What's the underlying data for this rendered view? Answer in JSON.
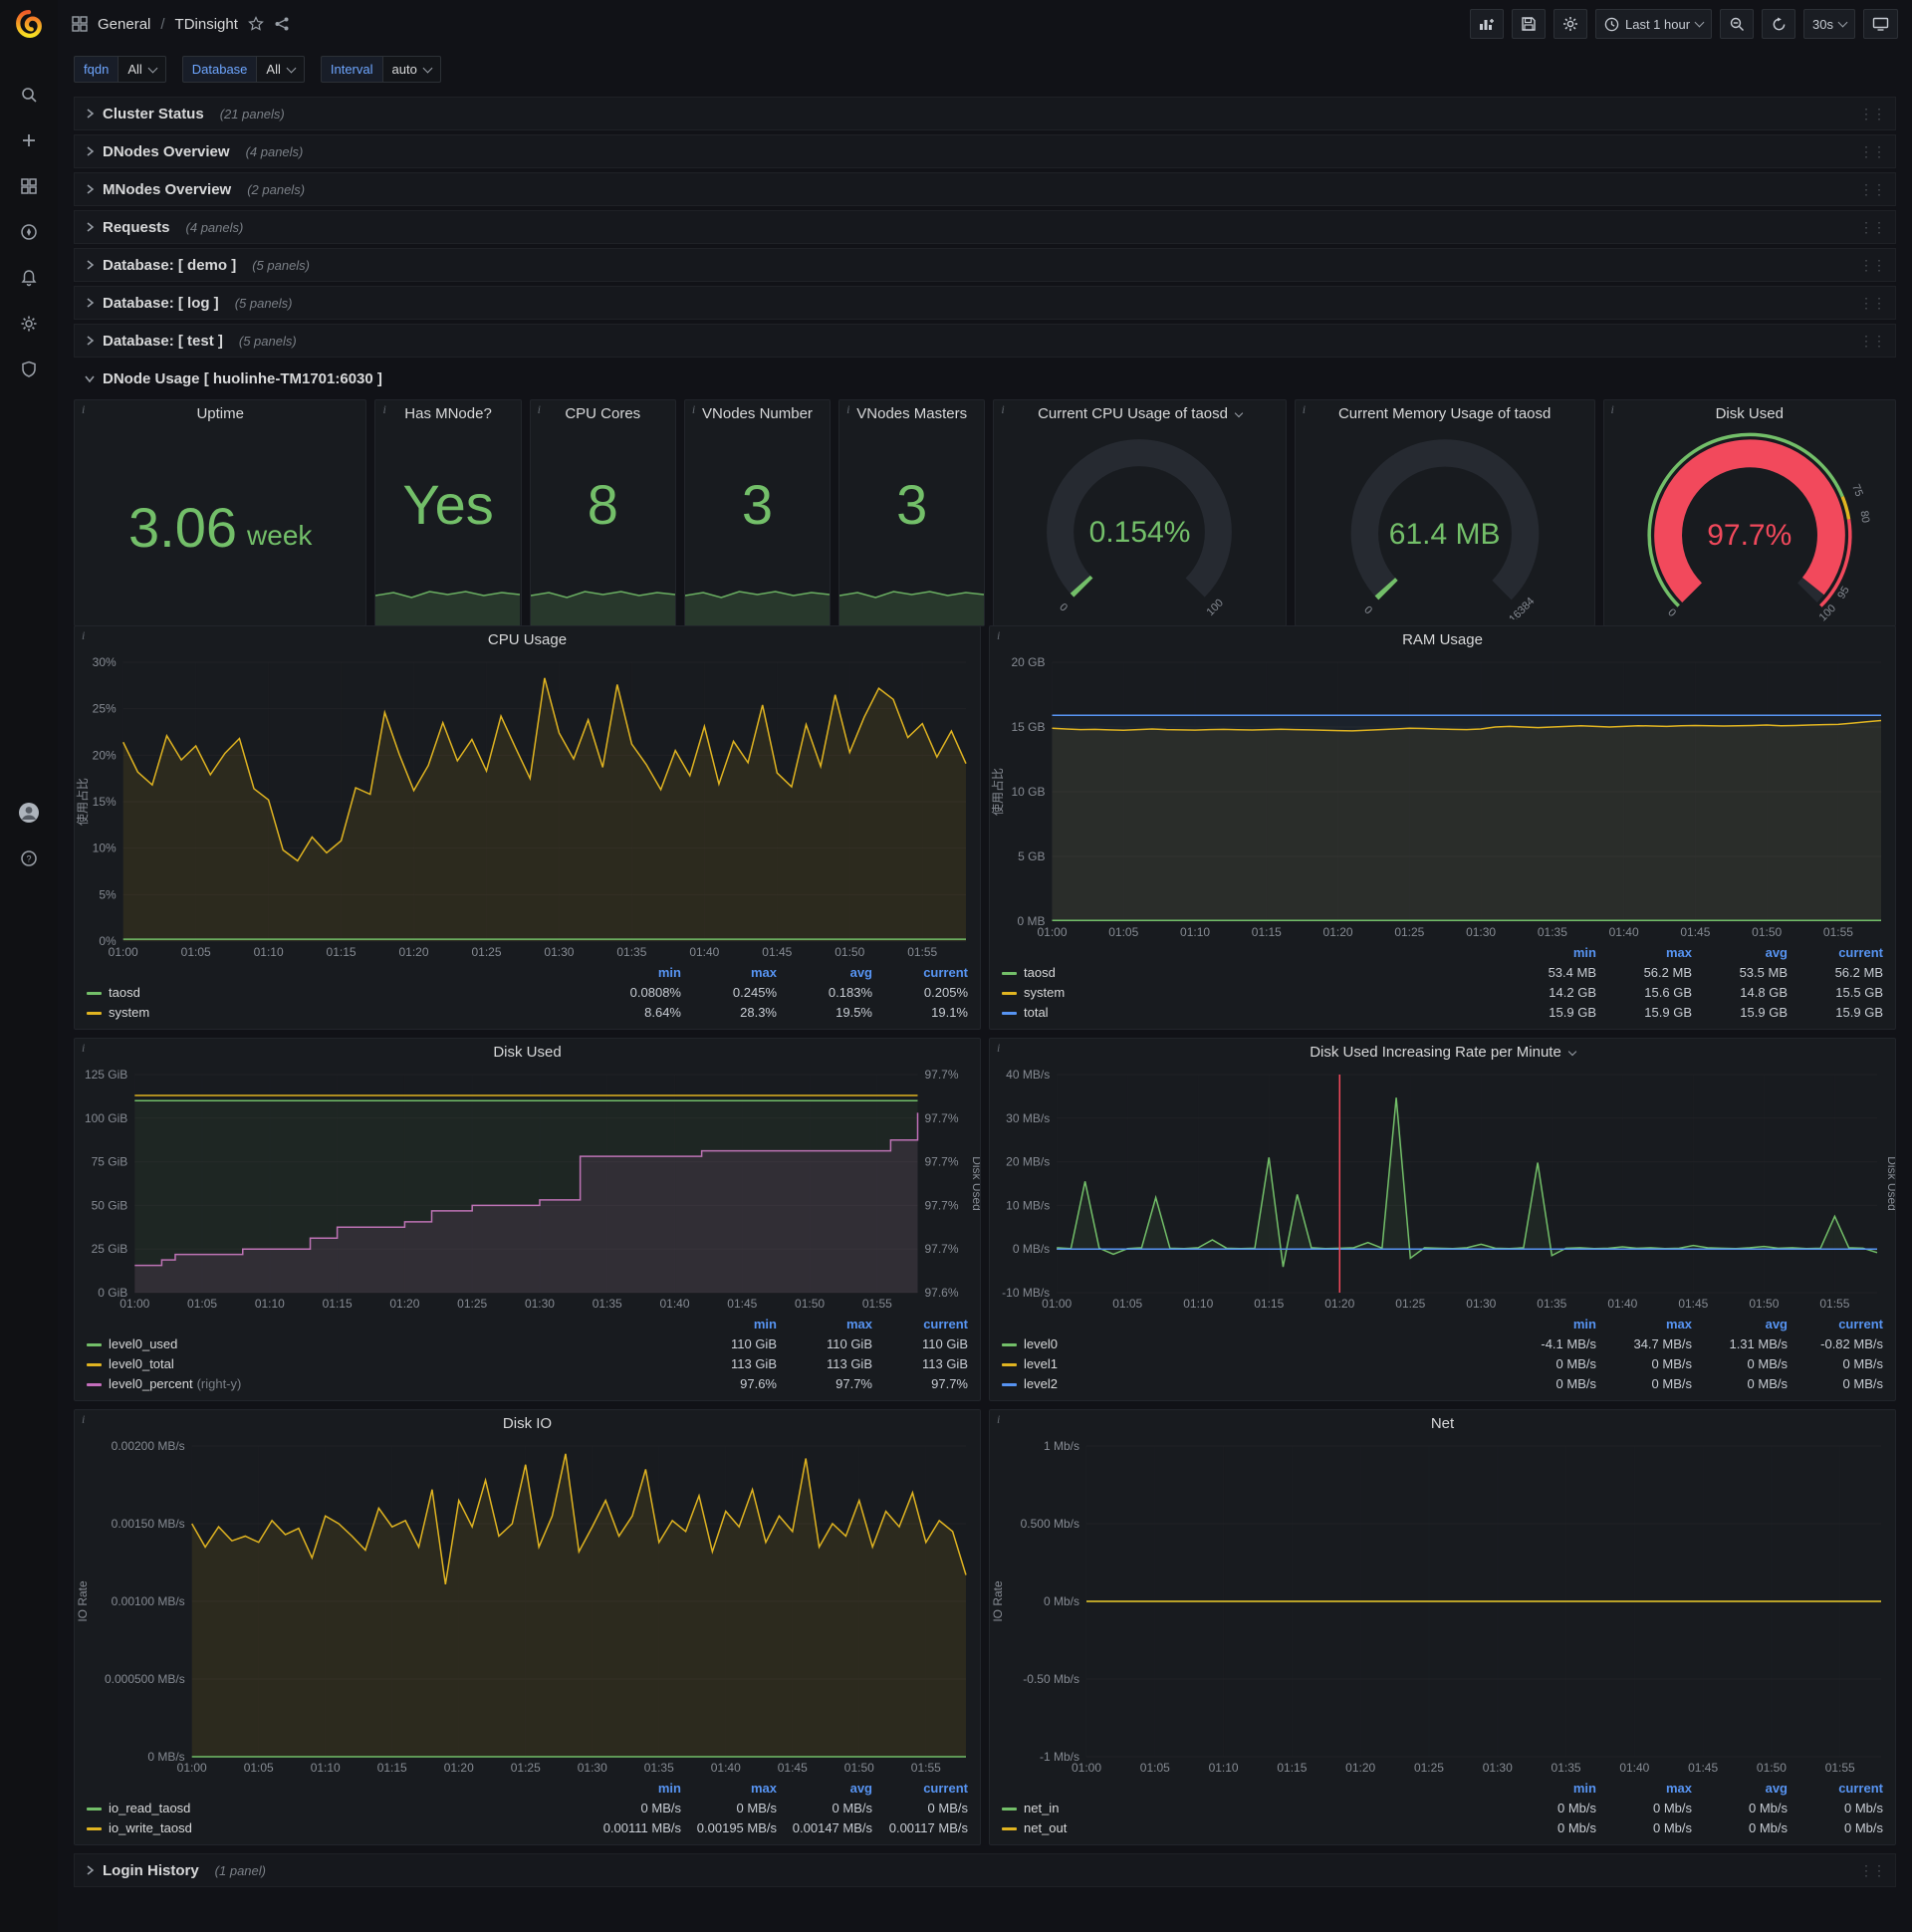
{
  "colors": {
    "green": "#73bf69",
    "yellow": "#e0b421",
    "blue": "#5794f2",
    "purple": "#c46ebc",
    "red": "#f2495c"
  },
  "topbar": {
    "section": "General",
    "title": "TDinsight",
    "time_range": "Last 1 hour",
    "refresh": "30s"
  },
  "variables": [
    {
      "label": "fqdn",
      "value": "All"
    },
    {
      "label": "Database",
      "value": "All"
    },
    {
      "label": "Interval",
      "value": "auto"
    }
  ],
  "rows_top": [
    {
      "title": "Cluster Status",
      "count": "(21 panels)"
    },
    {
      "title": "DNodes Overview",
      "count": "(4 panels)"
    },
    {
      "title": "MNodes Overview",
      "count": "(2 panels)"
    },
    {
      "title": "Requests",
      "count": "(4 panels)"
    },
    {
      "title": "Database: [ demo ]",
      "count": "(5 panels)"
    },
    {
      "title": "Database: [ log ]",
      "count": "(5 panels)"
    },
    {
      "title": "Database: [ test ]",
      "count": "(5 panels)"
    }
  ],
  "dnode_row_title": "DNode Usage [ huolinhe-TM1701:6030 ]",
  "rows_bottom": [
    {
      "title": "Login History",
      "count": "(1 panel)"
    }
  ],
  "stats": [
    {
      "title": "Uptime",
      "value": "3.06",
      "unit": "week",
      "spark": false
    },
    {
      "title": "Has MNode?",
      "value": "Yes",
      "spark": true
    },
    {
      "title": "CPU Cores",
      "value": "8",
      "spark": true
    },
    {
      "title": "VNodes Number",
      "value": "3",
      "spark": true
    },
    {
      "title": "VNodes Masters",
      "value": "3",
      "spark": true
    }
  ],
  "gauges": [
    {
      "title": "Current CPU Usage of taosd",
      "value": "0.154%",
      "percent": 0.154,
      "color": "#73bf69",
      "labels": [
        {
          "pct": 0,
          "text": "0"
        },
        {
          "pct": 100,
          "text": "100"
        }
      ]
    },
    {
      "title": "Current Memory Usage of taosd",
      "value": "61.4 MB",
      "percent": 0.375,
      "color": "#73bf69",
      "labels": [
        {
          "pct": 0,
          "text": "0"
        },
        {
          "pct": 100,
          "text": "16384"
        }
      ]
    },
    {
      "title": "Disk Used",
      "value": "97.7%",
      "percent": 97.7,
      "color": "#f2495c",
      "band": [
        {
          "from": 0,
          "to": 75,
          "color": "#73bf69"
        },
        {
          "from": 75,
          "to": 80,
          "color": "#e0b421"
        },
        {
          "from": 80,
          "to": 100,
          "color": "#f2495c"
        }
      ],
      "labels": [
        {
          "pct": 0,
          "text": "0"
        },
        {
          "pct": 75,
          "text": "75"
        },
        {
          "pct": 80,
          "text": "80"
        },
        {
          "pct": 95,
          "text": "95"
        },
        {
          "pct": 100,
          "text": "100"
        }
      ]
    }
  ],
  "chart_data": {
    "cpu": {
      "type": "line",
      "title": "CPU Usage",
      "ylabel": "使用占比",
      "ylim": [
        0,
        30
      ],
      "x_max": 58,
      "y_ticks": [
        {
          "v": 0,
          "label": "0%"
        },
        {
          "v": 5,
          "label": "5%"
        },
        {
          "v": 10,
          "label": "10%"
        },
        {
          "v": 15,
          "label": "15%"
        },
        {
          "v": 20,
          "label": "20%"
        },
        {
          "v": 25,
          "label": "25%"
        },
        {
          "v": 30,
          "label": "30%"
        }
      ],
      "x_ticks": [
        "01:00",
        "01:05",
        "01:10",
        "01:15",
        "01:20",
        "01:25",
        "01:30",
        "01:35",
        "01:40",
        "01:45",
        "01:50",
        "01:55"
      ],
      "series": [
        {
          "name": "system",
          "color": "yellow",
          "fill": 0.1,
          "values": [
            21.4,
            18.2,
            16.8,
            22.1,
            19.5,
            21.0,
            17.9,
            20.2,
            21.8,
            16.4,
            15.2,
            9.8,
            8.64,
            11.2,
            9.5,
            10.8,
            16.5,
            15.8,
            24.6,
            20.1,
            16.2,
            18.9,
            23.5,
            19.4,
            21.7,
            18.3,
            24.2,
            20.8,
            17.5,
            28.3,
            22.4,
            19.6,
            23.8,
            18.7,
            27.6,
            21.2,
            19.0,
            16.3,
            20.5,
            17.8,
            23.1,
            16.9,
            21.5,
            19.2,
            25.4,
            18.1,
            16.6,
            23.3,
            18.8,
            26.5,
            20.3,
            24.1,
            27.2,
            26.0,
            21.9,
            23.4,
            19.8,
            22.6,
            19.1
          ]
        },
        {
          "name": "taosd",
          "color": "green",
          "const": 0.2
        }
      ],
      "legend": {
        "headers": [
          "min",
          "max",
          "avg",
          "current"
        ],
        "rows": [
          {
            "name": "taosd",
            "color": "green",
            "values": [
              "0.0808%",
              "0.245%",
              "0.183%",
              "0.205%"
            ]
          },
          {
            "name": "system",
            "color": "yellow",
            "values": [
              "8.64%",
              "28.3%",
              "19.5%",
              "19.1%"
            ]
          }
        ]
      }
    },
    "ram": {
      "type": "line",
      "title": "RAM Usage",
      "ylabel": "使用占比",
      "ylim": [
        0,
        20
      ],
      "x_max": 58,
      "y_ticks": [
        {
          "v": 0,
          "label": "0 MB"
        },
        {
          "v": 5,
          "label": "5 GB"
        },
        {
          "v": 10,
          "label": "10 GB"
        },
        {
          "v": 15,
          "label": "15 GB"
        },
        {
          "v": 20,
          "label": "20 GB"
        }
      ],
      "x_ticks": [
        "01:00",
        "01:05",
        "01:10",
        "01:15",
        "01:20",
        "01:25",
        "01:30",
        "01:35",
        "01:40",
        "01:45",
        "01:50",
        "01:55"
      ],
      "series": [
        {
          "name": "total",
          "color": "blue",
          "const": 15.9,
          "fill": 0.06
        },
        {
          "name": "system",
          "color": "yellow",
          "fill": 0.08,
          "values": [
            14.9,
            14.85,
            14.8,
            14.82,
            14.78,
            14.75,
            14.8,
            14.85,
            14.8,
            14.78,
            14.76,
            14.8,
            14.82,
            14.79,
            14.77,
            14.8,
            14.83,
            14.8,
            14.78,
            14.75,
            14.72,
            14.7,
            14.75,
            14.8,
            14.85,
            14.9,
            14.88,
            14.85,
            14.82,
            14.8,
            14.85,
            15.0,
            15.05,
            15.0,
            14.95,
            15.0,
            15.05,
            15.1,
            15.05,
            15.0,
            15.05,
            15.1,
            15.08,
            15.05,
            15.1,
            15.12,
            15.1,
            15.08,
            15.1,
            15.12,
            15.15,
            15.1,
            15.12,
            15.15,
            15.18,
            15.2,
            15.3,
            15.4,
            15.5
          ]
        },
        {
          "name": "taosd",
          "color": "green",
          "const": 0.053
        }
      ],
      "legend": {
        "headers": [
          "min",
          "max",
          "avg",
          "current"
        ],
        "rows": [
          {
            "name": "taosd",
            "color": "green",
            "values": [
              "53.4 MB",
              "56.2 MB",
              "53.5 MB",
              "56.2 MB"
            ]
          },
          {
            "name": "system",
            "color": "yellow",
            "values": [
              "14.2 GB",
              "15.6 GB",
              "14.8 GB",
              "15.5 GB"
            ]
          },
          {
            "name": "total",
            "color": "blue",
            "values": [
              "15.9 GB",
              "15.9 GB",
              "15.9 GB",
              "15.9 GB"
            ]
          }
        ]
      }
    },
    "disk": {
      "type": "line",
      "title": "Disk Used",
      "ylim": [
        0,
        125
      ],
      "y2lim": [
        97.64,
        97.72
      ],
      "y2label": "Disk Used",
      "x_max": 58,
      "y_ticks": [
        {
          "v": 0,
          "label": "0 GiB"
        },
        {
          "v": 25,
          "label": "25 GiB"
        },
        {
          "v": 50,
          "label": "50 GiB"
        },
        {
          "v": 75,
          "label": "75 GiB"
        },
        {
          "v": 100,
          "label": "100 GiB"
        },
        {
          "v": 125,
          "label": "125 GiB"
        }
      ],
      "y2_ticks": [
        "97.6%",
        "97.7%",
        "97.7%",
        "97.7%",
        "97.7%",
        "97.7%"
      ],
      "x_ticks": [
        "01:00",
        "01:05",
        "01:10",
        "01:15",
        "01:20",
        "01:25",
        "01:30",
        "01:35",
        "01:40",
        "01:45",
        "01:50",
        "01:55"
      ],
      "series": [
        {
          "name": "level0_percent",
          "color": "purple",
          "axis": "y2",
          "step": true,
          "fill": 0.12,
          "values": [
            97.65,
            97.65,
            97.652,
            97.654,
            97.654,
            97.654,
            97.654,
            97.654,
            97.656,
            97.656,
            97.656,
            97.656,
            97.656,
            97.66,
            97.66,
            97.664,
            97.664,
            97.664,
            97.664,
            97.664,
            97.666,
            97.666,
            97.67,
            97.67,
            97.67,
            97.672,
            97.672,
            97.672,
            97.672,
            97.672,
            97.674,
            97.674,
            97.674,
            97.69,
            97.69,
            97.69,
            97.69,
            97.69,
            97.69,
            97.69,
            97.69,
            97.69,
            97.692,
            97.692,
            97.692,
            97.692,
            97.692,
            97.692,
            97.692,
            97.692,
            97.692,
            97.692,
            97.692,
            97.692,
            97.692,
            97.692,
            97.696,
            97.696,
            97.706
          ]
        },
        {
          "name": "level0_used",
          "color": "green",
          "const": 110,
          "fill": 0.07
        },
        {
          "name": "level0_total",
          "color": "yellow",
          "const": 113
        }
      ],
      "legend": {
        "headers": [
          "min",
          "max",
          "current"
        ],
        "rows": [
          {
            "name": "level0_used",
            "color": "green",
            "values": [
              "110 GiB",
              "110 GiB",
              "110 GiB"
            ]
          },
          {
            "name": "level0_total",
            "color": "yellow",
            "values": [
              "113 GiB",
              "113 GiB",
              "113 GiB"
            ]
          },
          {
            "name": "level0_percent",
            "suffix": "(right-y)",
            "color": "purple",
            "values": [
              "97.6%",
              "97.7%",
              "97.7%"
            ]
          }
        ]
      }
    },
    "rate": {
      "type": "line",
      "title": "Disk Used Increasing Rate per Minute",
      "has_caret": true,
      "ylim": [
        -10,
        40
      ],
      "y2label": "Disk Used",
      "x_max": 58,
      "y_ticks": [
        {
          "v": -10,
          "label": "-10 MB/s"
        },
        {
          "v": 0,
          "label": "0 MB/s"
        },
        {
          "v": 10,
          "label": "10 MB/s"
        },
        {
          "v": 20,
          "label": "20 MB/s"
        },
        {
          "v": 30,
          "label": "30 MB/s"
        },
        {
          "v": 40,
          "label": "40 MB/s"
        }
      ],
      "x_ticks": [
        "01:00",
        "01:05",
        "01:10",
        "01:15",
        "01:20",
        "01:25",
        "01:30",
        "01:35",
        "01:40",
        "01:45",
        "01:50",
        "01:55"
      ],
      "annotation": {
        "minute": 20,
        "color": "red"
      },
      "series": [
        {
          "name": "level0",
          "color": "green",
          "fill": 0.08,
          "values": [
            0.3,
            0.1,
            15.5,
            0.2,
            -1.2,
            0.1,
            0.3,
            11.8,
            0.2,
            0.1,
            0.3,
            2.1,
            0.2,
            0.1,
            0.2,
            21.0,
            -4.1,
            12.5,
            0.3,
            0.1,
            0.2,
            0.3,
            1.5,
            0.2,
            34.7,
            -2.1,
            0.3,
            0.2,
            0.1,
            0.3,
            1.1,
            0.2,
            0.1,
            0.3,
            19.8,
            -1.5,
            0.2,
            0.3,
            0.1,
            0.2,
            0.5,
            0.2,
            0.3,
            0.1,
            0.2,
            0.8,
            0.3,
            0.2,
            0.1,
            0.3,
            0.6,
            0.2,
            0.3,
            0.1,
            0.2,
            7.5,
            0.3,
            0.2,
            -0.82
          ]
        },
        {
          "name": "level1",
          "color": "yellow",
          "const": 0
        },
        {
          "name": "level2",
          "color": "blue",
          "const": 0
        }
      ],
      "legend": {
        "headers": [
          "min",
          "max",
          "avg",
          "current"
        ],
        "rows": [
          {
            "name": "level0",
            "color": "green",
            "values": [
              "-4.1 MB/s",
              "34.7 MB/s",
              "1.31 MB/s",
              "-0.82 MB/s"
            ]
          },
          {
            "name": "level1",
            "color": "yellow",
            "values": [
              "0 MB/s",
              "0 MB/s",
              "0 MB/s",
              "0 MB/s"
            ]
          },
          {
            "name": "level2",
            "color": "blue",
            "values": [
              "0 MB/s",
              "0 MB/s",
              "0 MB/s",
              "0 MB/s"
            ]
          }
        ]
      }
    },
    "io": {
      "type": "line",
      "title": "Disk IO",
      "ylabel": "IO Rate",
      "ylim": [
        0,
        0.002
      ],
      "x_max": 58,
      "y_ticks": [
        {
          "v": 0,
          "label": "0 MB/s"
        },
        {
          "v": 0.0005,
          "label": "0.000500 MB/s"
        },
        {
          "v": 0.001,
          "label": "0.00100 MB/s"
        },
        {
          "v": 0.0015,
          "label": "0.00150 MB/s"
        },
        {
          "v": 0.002,
          "label": "0.00200 MB/s"
        }
      ],
      "x_ticks": [
        "01:00",
        "01:05",
        "01:10",
        "01:15",
        "01:20",
        "01:25",
        "01:30",
        "01:35",
        "01:40",
        "01:45",
        "01:50",
        "01:55"
      ],
      "series": [
        {
          "name": "io_write_taosd",
          "color": "yellow",
          "fill": 0.1,
          "values": [
            0.0015,
            0.00135,
            0.00148,
            0.00139,
            0.00142,
            0.00138,
            0.00152,
            0.00143,
            0.00147,
            0.00128,
            0.00155,
            0.0015,
            0.00142,
            0.00133,
            0.0016,
            0.00148,
            0.00152,
            0.00135,
            0.00172,
            0.00111,
            0.00165,
            0.00148,
            0.00178,
            0.00142,
            0.0015,
            0.00188,
            0.00135,
            0.00155,
            0.00195,
            0.00132,
            0.00148,
            0.00165,
            0.00142,
            0.00155,
            0.00185,
            0.00138,
            0.00152,
            0.00145,
            0.00168,
            0.00132,
            0.00158,
            0.00148,
            0.00172,
            0.00138,
            0.00155,
            0.00145,
            0.00192,
            0.00135,
            0.0015,
            0.00142,
            0.00165,
            0.00135,
            0.00158,
            0.00148,
            0.0017,
            0.00138,
            0.00152,
            0.00145,
            0.00117
          ]
        },
        {
          "name": "io_read_taosd",
          "color": "green",
          "const": 0
        }
      ],
      "legend": {
        "headers": [
          "min",
          "max",
          "avg",
          "current"
        ],
        "rows": [
          {
            "name": "io_read_taosd",
            "color": "green",
            "values": [
              "0 MB/s",
              "0 MB/s",
              "0 MB/s",
              "0 MB/s"
            ]
          },
          {
            "name": "io_write_taosd",
            "color": "yellow",
            "values": [
              "0.00111 MB/s",
              "0.00195 MB/s",
              "0.00147 MB/s",
              "0.00117 MB/s"
            ]
          }
        ]
      }
    },
    "net": {
      "type": "line",
      "title": "Net",
      "ylabel": "IO Rate",
      "ylim": [
        -1,
        1
      ],
      "x_max": 58,
      "y_ticks": [
        {
          "v": -1,
          "label": "-1 Mb/s"
        },
        {
          "v": -0.5,
          "label": "-0.50 Mb/s"
        },
        {
          "v": 0,
          "label": "0 Mb/s"
        },
        {
          "v": 0.5,
          "label": "0.500 Mb/s"
        },
        {
          "v": 1,
          "label": "1 Mb/s"
        }
      ],
      "x_ticks": [
        "01:00",
        "01:05",
        "01:10",
        "01:15",
        "01:20",
        "01:25",
        "01:30",
        "01:35",
        "01:40",
        "01:45",
        "01:50",
        "01:55"
      ],
      "series": [
        {
          "name": "net_in",
          "color": "green",
          "const": 0
        },
        {
          "name": "net_out",
          "color": "yellow",
          "const": 0
        }
      ],
      "legend": {
        "headers": [
          "min",
          "max",
          "avg",
          "current"
        ],
        "rows": [
          {
            "name": "net_in",
            "color": "green",
            "values": [
              "0 Mb/s",
              "0 Mb/s",
              "0 Mb/s",
              "0 Mb/s"
            ]
          },
          {
            "name": "net_out",
            "color": "yellow",
            "values": [
              "0 Mb/s",
              "0 Mb/s",
              "0 Mb/s",
              "0 Mb/s"
            ]
          }
        ]
      }
    }
  }
}
